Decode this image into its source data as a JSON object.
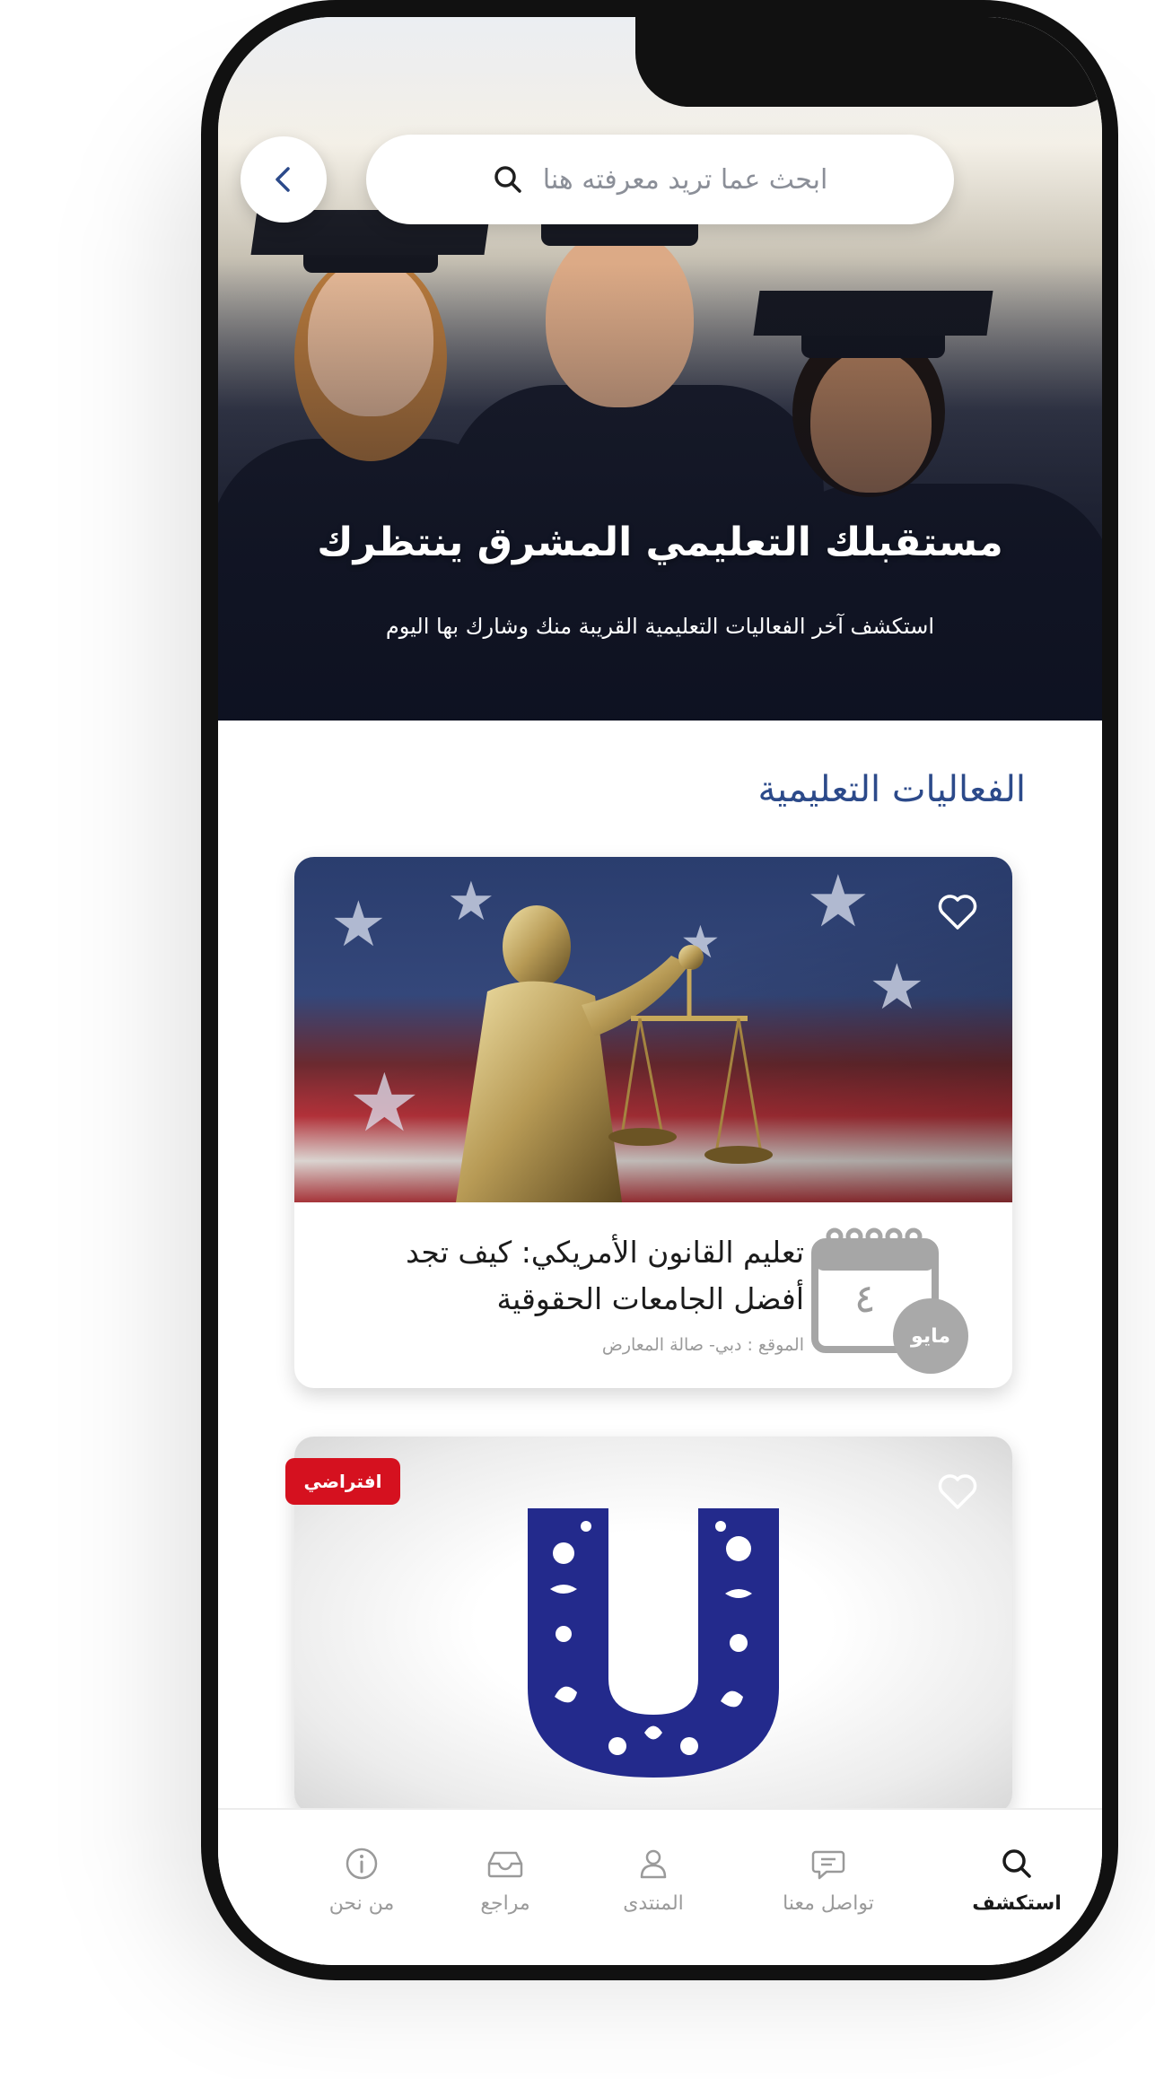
{
  "search": {
    "placeholder": "ابحث عما تريد معرفته هنا"
  },
  "hero": {
    "title": "مستقبلك التعليمي المشرق ينتظرك",
    "subtitle": "استكشف آخر الفعاليات التعليمية القريبة منك وشارك بها اليوم"
  },
  "section": {
    "title": "الفعاليات التعليمية"
  },
  "events": [
    {
      "title": "تعليم القانون الأمريكي: كيف تجد أفضل الجامعات الحقوقية",
      "location": "الموقع : دبي- صالة المعارض",
      "day": "٤",
      "month": "مايو",
      "favorite": false
    },
    {
      "badge": "افتراضي",
      "favorite": false
    }
  ],
  "nav": {
    "items": [
      {
        "label": "استكشف",
        "icon": "search-icon",
        "active": true
      },
      {
        "label": "تواصل معنا",
        "icon": "chat-icon",
        "active": false
      },
      {
        "label": "المنتدى",
        "icon": "user-icon",
        "active": false
      },
      {
        "label": "مراجع",
        "icon": "inbox-icon",
        "active": false
      },
      {
        "label": "من نحن",
        "icon": "info-icon",
        "active": false
      }
    ]
  },
  "colors": {
    "accent": "#2c4a8a",
    "badge": "#d5111f",
    "active_nav": "#1a1a1a",
    "inactive_nav": "#9a9a9a"
  }
}
